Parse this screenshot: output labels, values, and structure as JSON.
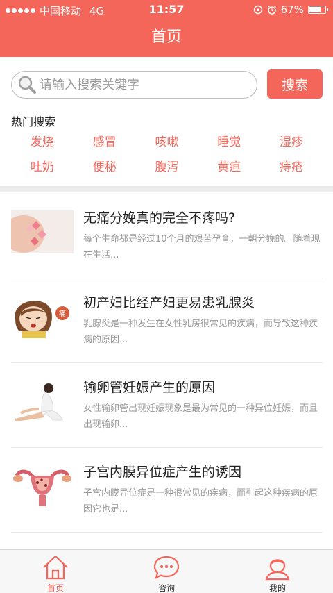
{
  "status": {
    "carrier": "中国移动",
    "network": "4G",
    "time": "11:57",
    "battery": "67%",
    "battery_level": 0.67
  },
  "nav": {
    "title": "首页"
  },
  "search": {
    "placeholder": "请输入搜索关键字",
    "value": "",
    "button_label": "搜索"
  },
  "hot": {
    "title": "热门搜索",
    "items": [
      "发烧",
      "感冒",
      "咳嗽",
      "睡觉",
      "湿疹",
      "吐奶",
      "便秘",
      "腹泻",
      "黄疸",
      "痔疮"
    ]
  },
  "articles": [
    {
      "title": "无痛分娩真的完全不疼吗?",
      "summary": "每个生命都是经过10个月的艰苦孕育，一朝分娩的。随着现在生活...",
      "thumb_icon": "pregnant-belly-image"
    },
    {
      "title": "初产妇比经产妇更易患乳腺炎",
      "summary": "乳腺炎是一种发生在女性乳房很常见的疾病，而导致这种疾病的原因...",
      "thumb_icon": "cartoon-woman-in-pain-image",
      "thumb_badge": "痛"
    },
    {
      "title": "输卵管妊娠产生的原因",
      "summary": "女性输卵管出现妊娠现象是最为常见的一种异位妊娠，而且出现输卵...",
      "thumb_icon": "woman-sitting-image"
    },
    {
      "title": "子宫内膜异位症产生的诱因",
      "summary": "子宫内膜异位症是一种很常见的疾病，而引起这种疾病的原因它也是...",
      "thumb_icon": "uterus-anatomy-image"
    }
  ],
  "tabs": [
    {
      "label": "首页",
      "icon": "home-icon",
      "active": true
    },
    {
      "label": "咨询",
      "icon": "chat-icon",
      "active": false
    },
    {
      "label": "我的",
      "icon": "user-icon",
      "active": false
    }
  ],
  "colors": {
    "accent": "#f5665a",
    "muted_text": "#999999",
    "divider": "#ececec"
  }
}
